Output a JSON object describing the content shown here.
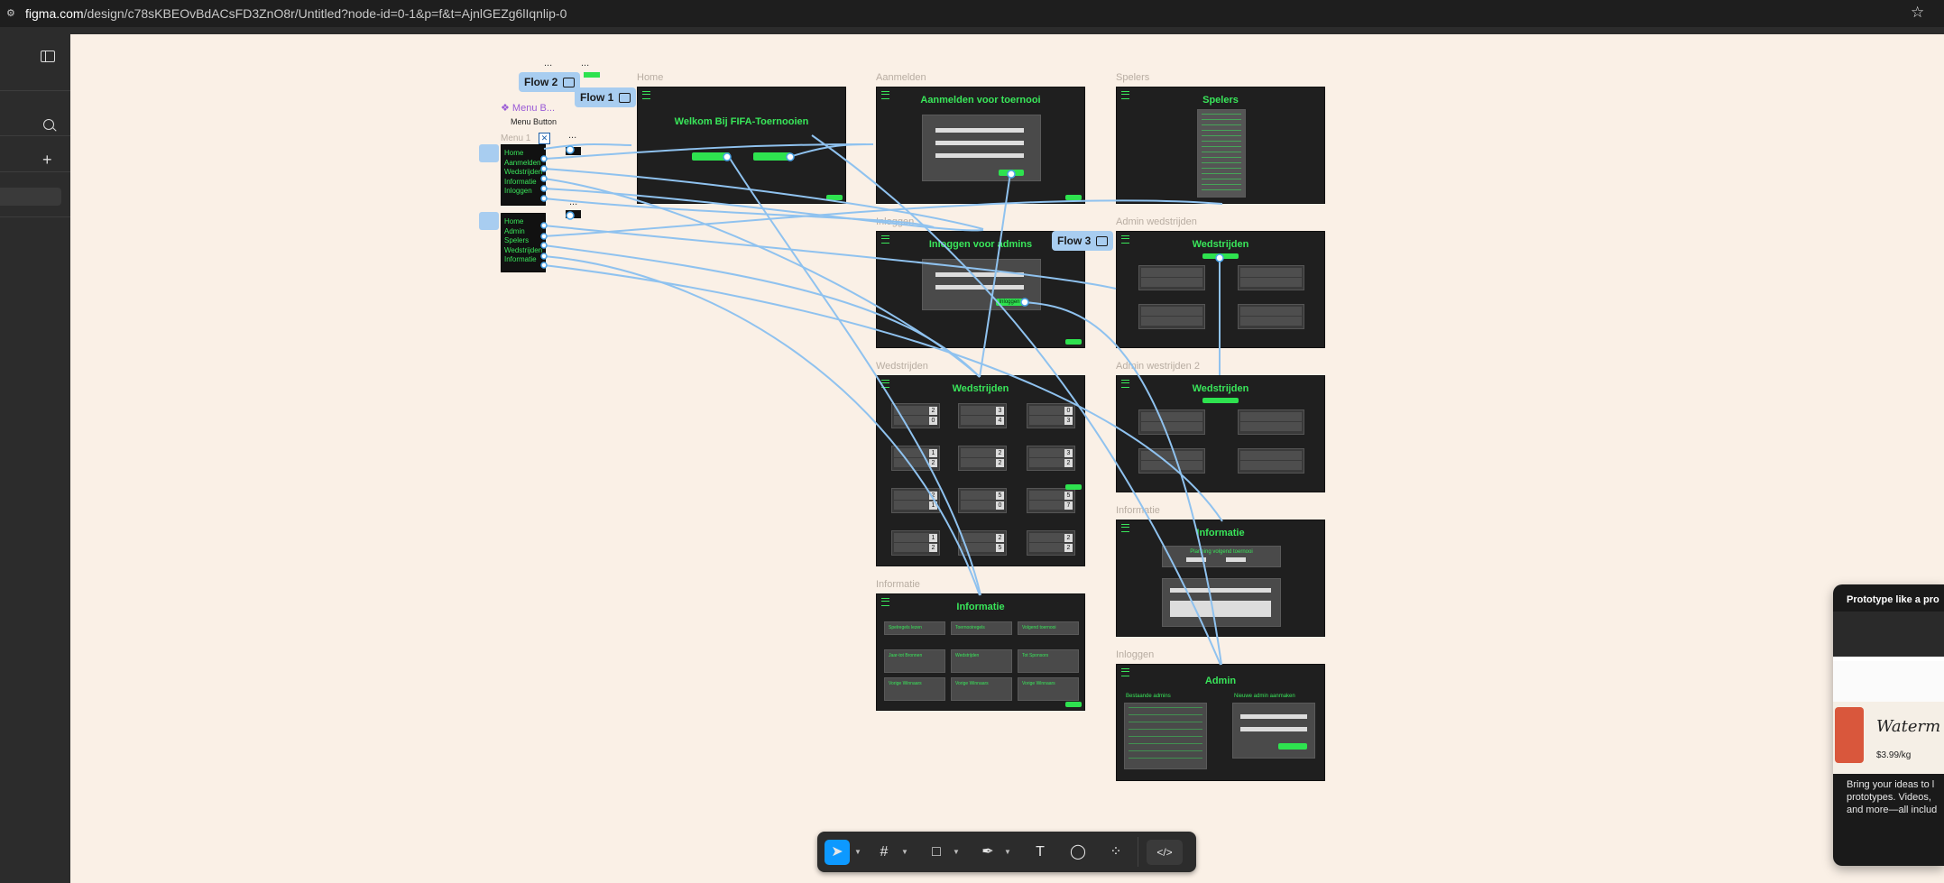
{
  "browser": {
    "url_host": "figma.com",
    "url_path": "/design/c78sKBEOvBdACsFD3ZnO8r/Untitled?node-id=0-1&p=f&t=AjnlGEZg6lIqnlip-0"
  },
  "frames": {
    "home": {
      "label": "Home",
      "title": "Welkom Bij FIFA-Toernooien"
    },
    "aanmelden": {
      "label": "Aanmelden",
      "title": "Aanmelden voor toernooi"
    },
    "spelers": {
      "label": "Spelers",
      "title": "Spelers"
    },
    "inloggen": {
      "label": "Inloggen",
      "title": "Inloggen voor admins",
      "button": "Inloggen"
    },
    "admin_wedstrijden": {
      "label": "Admin wedstrijden",
      "title": "Wedstrijden"
    },
    "wedstrijden": {
      "label": "Wedstrijden",
      "title": "Wedstrijden"
    },
    "admin_wedstrijden_2": {
      "label": "Admin westrijden 2",
      "title": "Wedstrijden"
    },
    "informatie_1": {
      "label": "Informatie",
      "title": "Informatie"
    },
    "informatie_2": {
      "label": "Informatie",
      "title": "Informatie",
      "subtitle": "Planning volgend toernooi"
    },
    "admin": {
      "label": "Inloggen",
      "title": "Admin",
      "col1": "Bestaande admins",
      "col2": "Nieuwe admin aanmaken"
    }
  },
  "informatie_cards": [
    "Spelregels lezen",
    "Toernooiregels",
    "Volgend toernooi",
    "Jaar-tot Bronnen",
    "Wedstrijden",
    "Tot Sponsors",
    "Vorige Winnaars",
    "Vorige Winnaars",
    "Vorige Winnaars"
  ],
  "flows": {
    "flow1": "Flow 1",
    "flow2": "Flow 2",
    "flow3": "Flow 3"
  },
  "component": {
    "title": "Menu B...",
    "subtitle": "Menu Button",
    "label": "Menu 1"
  },
  "menu1_items": [
    "Home",
    "Aanmelden",
    "Wedstrijden",
    "Informatie",
    "Inloggen"
  ],
  "menu2_items": [
    "Home",
    "Admin",
    "Spelers",
    "Wedstrijden",
    "Informatie"
  ],
  "ellipsis": "...",
  "scores_left": [
    2,
    0,
    1,
    2,
    2,
    1,
    1,
    2
  ],
  "scores_mid": [
    3,
    4,
    2,
    2,
    5,
    0,
    2,
    5
  ],
  "scores_right": [
    0,
    3,
    3,
    2,
    5,
    7,
    2,
    2
  ],
  "promo": {
    "header": "Prototype like a pro",
    "product": "Waterm",
    "price": "$3.99/kg",
    "desc1": "Bring your ideas to l",
    "desc2": "prototypes. Videos,",
    "desc3": "and more—all includ"
  },
  "toolbar_code": "</>",
  "colors": {
    "canvas": "#faf0e6",
    "frame": "#1f1f1f",
    "accent_green": "#39e65a",
    "flow_blue": "#a8cdf0",
    "connector": "#8fc2ef"
  }
}
